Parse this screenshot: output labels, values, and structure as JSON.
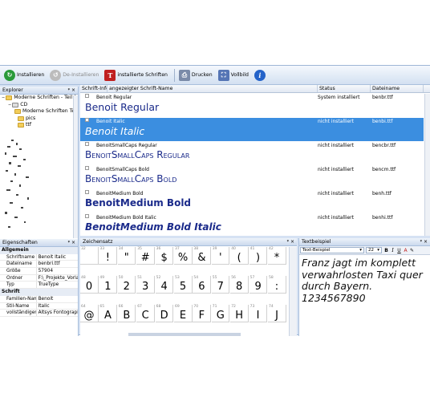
{
  "toolbar": {
    "install": "Installieren",
    "uninstall": "De-Installieren",
    "installed": "installierte Schriften",
    "print": "Drucken",
    "fullscreen": "Vollbild"
  },
  "explorer": {
    "title": "Explorer",
    "tree": [
      "Moderne Schriften - Teil 1",
      "CD",
      "Moderne Schriften Teil",
      "pics",
      "ttf"
    ]
  },
  "properties": {
    "title": "Eigenschaften",
    "cat_general": "Allgemein",
    "general": [
      {
        "k": "Schriftname",
        "v": "Benoit Italic"
      },
      {
        "k": "Dateiname",
        "v": "benbri.ttf"
      },
      {
        "k": "Größe",
        "v": "57904"
      },
      {
        "k": "Ordner",
        "v": "F:\\_Projekte_Vorla"
      },
      {
        "k": "Typ",
        "v": "TrueType"
      }
    ],
    "cat_font": "Schrift",
    "font": [
      {
        "k": "Familien-Name",
        "v": "Benoit"
      },
      {
        "k": "Stil-Name",
        "v": "Italic"
      },
      {
        "k": "vollständiger N.",
        "v": "Altsys Fontograph"
      }
    ]
  },
  "list": {
    "headers": [
      "Schrift-Info",
      "angezeigter Schrift-Name",
      "Status",
      "Dateiname"
    ],
    "rows": [
      {
        "name": "Benoit Regular",
        "status": "System installiert",
        "file": "benbr.ttf",
        "sample": "Benoit Regular",
        "selected": false
      },
      {
        "name": "Benoit Italic",
        "status": "nicht installiert",
        "file": "benbi.ttf",
        "sample": "Benoit Italic",
        "selected": true
      },
      {
        "name": "BenoitSmallCaps Regular",
        "status": "nicht installiert",
        "file": "bencbr.ttf",
        "sample": "BenoitSmallCaps Regular",
        "selected": false
      },
      {
        "name": "BenoitSmallCaps Bold",
        "status": "nicht installiert",
        "file": "bencm.ttf",
        "sample": "BenoitSmallCaps Bold",
        "selected": false
      },
      {
        "name": "BenoitMedium Bold",
        "status": "nicht installiert",
        "file": "benh.ttf",
        "sample": "BenoitMedium Bold",
        "selected": false
      },
      {
        "name": "BenoitMedium Bold Italic",
        "status": "nicht installiert",
        "file": "benhi.ttf",
        "sample": "BenoitMedium Bold Italic",
        "selected": false
      }
    ]
  },
  "charset": {
    "title": "Zeichensatz",
    "rows": [
      [
        {
          "c": "32",
          "ch": ""
        },
        {
          "c": "33",
          "ch": "!"
        },
        {
          "c": "34",
          "ch": "\""
        },
        {
          "c": "35",
          "ch": "#"
        },
        {
          "c": "36",
          "ch": "$"
        },
        {
          "c": "37",
          "ch": "%"
        },
        {
          "c": "38",
          "ch": "&"
        },
        {
          "c": "39",
          "ch": "'"
        },
        {
          "c": "40",
          "ch": "("
        },
        {
          "c": "41",
          "ch": ")"
        },
        {
          "c": "42",
          "ch": "*"
        }
      ],
      [
        {
          "c": "48",
          "ch": "0"
        },
        {
          "c": "49",
          "ch": "1"
        },
        {
          "c": "50",
          "ch": "2"
        },
        {
          "c": "51",
          "ch": "3"
        },
        {
          "c": "52",
          "ch": "4"
        },
        {
          "c": "53",
          "ch": "5"
        },
        {
          "c": "54",
          "ch": "6"
        },
        {
          "c": "55",
          "ch": "7"
        },
        {
          "c": "56",
          "ch": "8"
        },
        {
          "c": "57",
          "ch": "9"
        },
        {
          "c": "58",
          "ch": ":"
        }
      ],
      [
        {
          "c": "64",
          "ch": "@"
        },
        {
          "c": "65",
          "ch": "A"
        },
        {
          "c": "66",
          "ch": "B"
        },
        {
          "c": "67",
          "ch": "C"
        },
        {
          "c": "68",
          "ch": "D"
        },
        {
          "c": "69",
          "ch": "E"
        },
        {
          "c": "70",
          "ch": "F"
        },
        {
          "c": "71",
          "ch": "G"
        },
        {
          "c": "72",
          "ch": "H"
        },
        {
          "c": "73",
          "ch": "I"
        },
        {
          "c": "74",
          "ch": "J"
        }
      ]
    ]
  },
  "textbeispiel": {
    "title": "Textbeispiel",
    "mode": "Text-Beispiel",
    "size": "22",
    "text": "Franz jagt im komplett verwahrlosten Taxi quer durch Bayern. 1234567890"
  }
}
